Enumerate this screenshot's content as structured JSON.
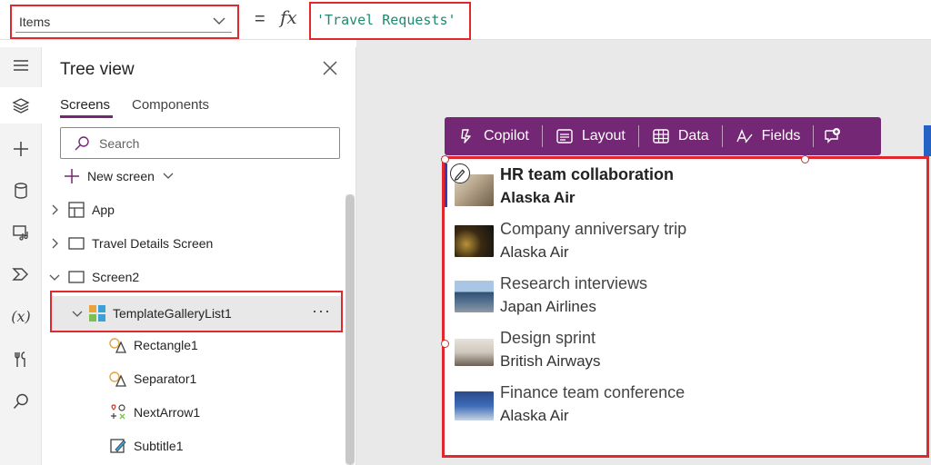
{
  "formula_bar": {
    "property": "Items",
    "equals": "=",
    "fx": "fx",
    "formula": "'Travel Requests'"
  },
  "rail": {
    "icons": [
      "menu-icon",
      "layers-icon",
      "insert-icon",
      "data-icon",
      "media-icon",
      "power-automate-icon",
      "variables-icon",
      "tools-icon",
      "search-icon"
    ],
    "variables_label": "(x)"
  },
  "tree": {
    "title": "Tree view",
    "tabs": [
      {
        "label": "Screens",
        "active": true
      },
      {
        "label": "Components",
        "active": false
      }
    ],
    "search_placeholder": "Search",
    "new_screen": "New screen",
    "nodes": [
      {
        "label": "App",
        "icon": "app-icon",
        "expandable": true,
        "level": 0
      },
      {
        "label": "Travel Details Screen",
        "icon": "screen-icon",
        "expandable": true,
        "level": 0
      },
      {
        "label": "Screen2",
        "icon": "screen-icon",
        "expandable": true,
        "expanded": true,
        "level": 0
      },
      {
        "label": "TemplateGalleryList1",
        "icon": "gallery-icon",
        "expandable": true,
        "expanded": true,
        "level": 1,
        "selected": true,
        "more": "···"
      },
      {
        "label": "Rectangle1",
        "icon": "shape-icon",
        "level": 2
      },
      {
        "label": "Separator1",
        "icon": "shape-icon",
        "level": 2
      },
      {
        "label": "NextArrow1",
        "icon": "icons-control-icon",
        "level": 2
      },
      {
        "label": "Subtitle1",
        "icon": "label-icon",
        "level": 2
      }
    ]
  },
  "toolbar": {
    "buttons": [
      {
        "label": "Copilot",
        "icon": "copilot-icon"
      },
      {
        "label": "Layout",
        "icon": "layout-icon"
      },
      {
        "label": "Data",
        "icon": "table-icon"
      },
      {
        "label": "Fields",
        "icon": "fields-icon"
      }
    ],
    "feedback_icon": "comment-add-icon"
  },
  "gallery": {
    "items": [
      {
        "title": "HR team collaboration",
        "subtitle": "Alaska Air"
      },
      {
        "title": "Company anniversary trip",
        "subtitle": "Alaska Air"
      },
      {
        "title": "Research interviews",
        "subtitle": "Japan Airlines"
      },
      {
        "title": "Design sprint",
        "subtitle": "British Airways"
      },
      {
        "title": "Finance team conference",
        "subtitle": "Alaska Air"
      }
    ]
  },
  "colors": {
    "accent_purple": "#742774",
    "highlight_red": "#e0282e",
    "formula_green": "#1e8a6e"
  }
}
